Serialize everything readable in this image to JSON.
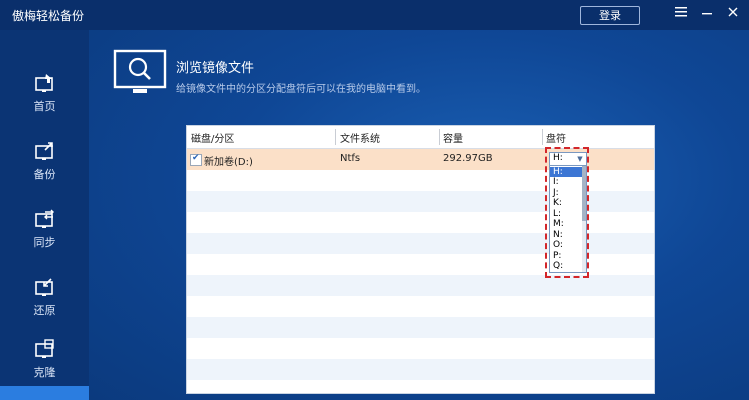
{
  "app": {
    "title": "傲梅轻松备份",
    "login_label": "登录"
  },
  "sidebar": {
    "items": [
      {
        "label": "首页",
        "icon": "home-icon"
      },
      {
        "label": "备份",
        "icon": "backup-icon"
      },
      {
        "label": "同步",
        "icon": "sync-icon"
      },
      {
        "label": "还原",
        "icon": "restore-icon"
      },
      {
        "label": "克隆",
        "icon": "clone-icon"
      }
    ]
  },
  "page": {
    "title": "浏览镜像文件",
    "description": "给镜像文件中的分区分配盘符后可以在我的电脑中看到。"
  },
  "table": {
    "columns": [
      "磁盘/分区",
      "文件系统",
      "容量",
      "盘符"
    ],
    "rows": [
      {
        "checked": true,
        "name": "新加卷(D:)",
        "fs": "Ntfs",
        "capacity": "292.97GB",
        "letter": "H:"
      }
    ]
  },
  "drive_select": {
    "value": "H:",
    "options": [
      "H:",
      "I:",
      "J:",
      "K:",
      "L:",
      "M:",
      "N:",
      "O:",
      "P:",
      "Q:"
    ],
    "highlighted": "H:"
  },
  "colors": {
    "accent": "#2b7de0",
    "selected_row": "#fbe0c8",
    "highlight_dash": "#d3262a"
  }
}
